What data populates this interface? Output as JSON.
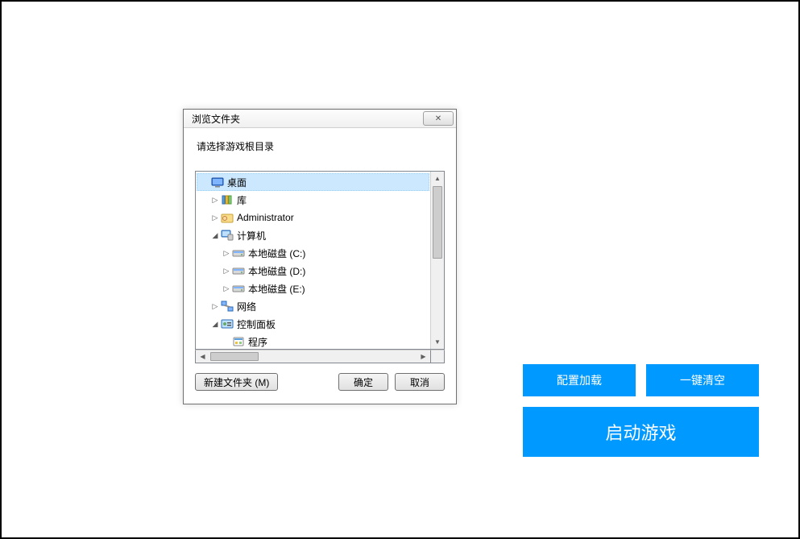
{
  "dialog": {
    "title": "浏览文件夹",
    "prompt": "请选择游戏根目录",
    "close_symbol": "✕",
    "buttons": {
      "new_folder": "新建文件夹 (M)",
      "ok": "确定",
      "cancel": "取消"
    }
  },
  "tree": [
    {
      "label": "桌面",
      "icon": "desktop",
      "indent": 0,
      "expander": "",
      "selected": true
    },
    {
      "label": "库",
      "icon": "library",
      "indent": 1,
      "expander": "▷"
    },
    {
      "label": "Administrator",
      "icon": "user",
      "indent": 1,
      "expander": "▷"
    },
    {
      "label": "计算机",
      "icon": "computer",
      "indent": 1,
      "expander": "◢"
    },
    {
      "label": "本地磁盘 (C:)",
      "icon": "drive",
      "indent": 2,
      "expander": "▷"
    },
    {
      "label": "本地磁盘 (D:)",
      "icon": "drive",
      "indent": 2,
      "expander": "▷"
    },
    {
      "label": "本地磁盘 (E:)",
      "icon": "drive",
      "indent": 2,
      "expander": "▷"
    },
    {
      "label": "网络",
      "icon": "network",
      "indent": 1,
      "expander": "▷"
    },
    {
      "label": "控制面板",
      "icon": "control-panel",
      "indent": 1,
      "expander": "◢"
    },
    {
      "label": "程序",
      "icon": "programs",
      "indent": 2,
      "expander": ""
    }
  ],
  "right": {
    "config_load": "配置加载",
    "one_key_clear": "一键清空",
    "launch_game": "启动游戏"
  }
}
